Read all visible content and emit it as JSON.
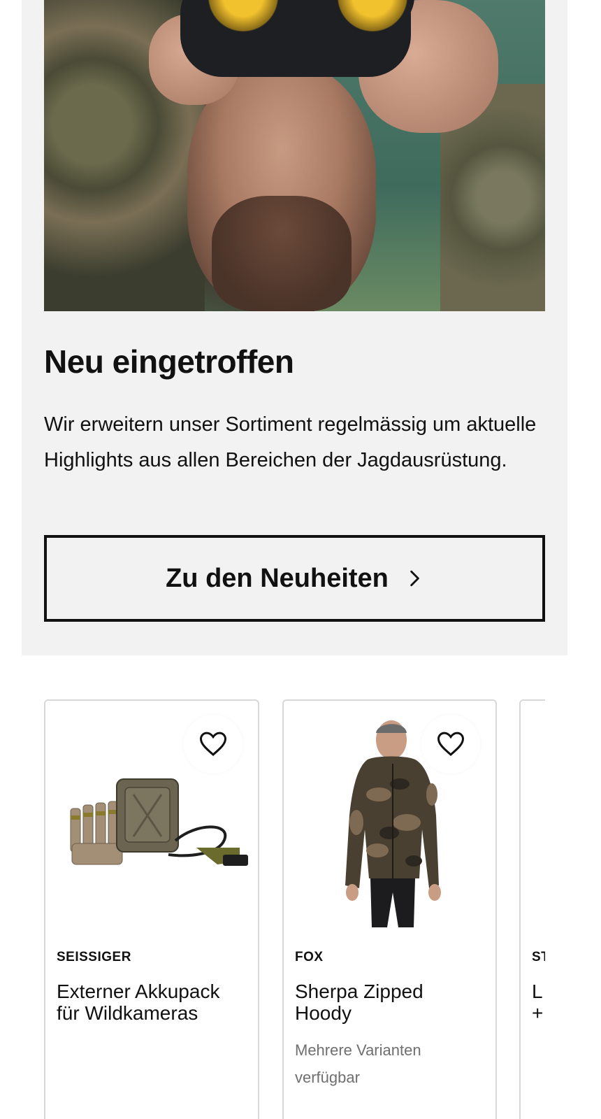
{
  "promo": {
    "title": "Neu eingetroffen",
    "text": "Wir erweitern unser Sortiment regelmässig um aktuelle Highlights aus allen Bereichen der Jagdausrüstung.",
    "button_label": "Zu den Neuheiten",
    "button_icon": "chevron-right-icon"
  },
  "products": [
    {
      "brand": "SEISSIGER",
      "name": "Externer Akkupack für Wildkameras",
      "variants": "",
      "fav_icon": "heart-outline-icon"
    },
    {
      "brand": "FOX",
      "name": "Sherpa Zipped Hoody",
      "variants": "Mehrere Varianten verfügbar",
      "fav_icon": "heart-outline-icon"
    },
    {
      "brand": "ST",
      "name": "L\n+",
      "variants": "",
      "fav_icon": "heart-outline-icon"
    }
  ]
}
